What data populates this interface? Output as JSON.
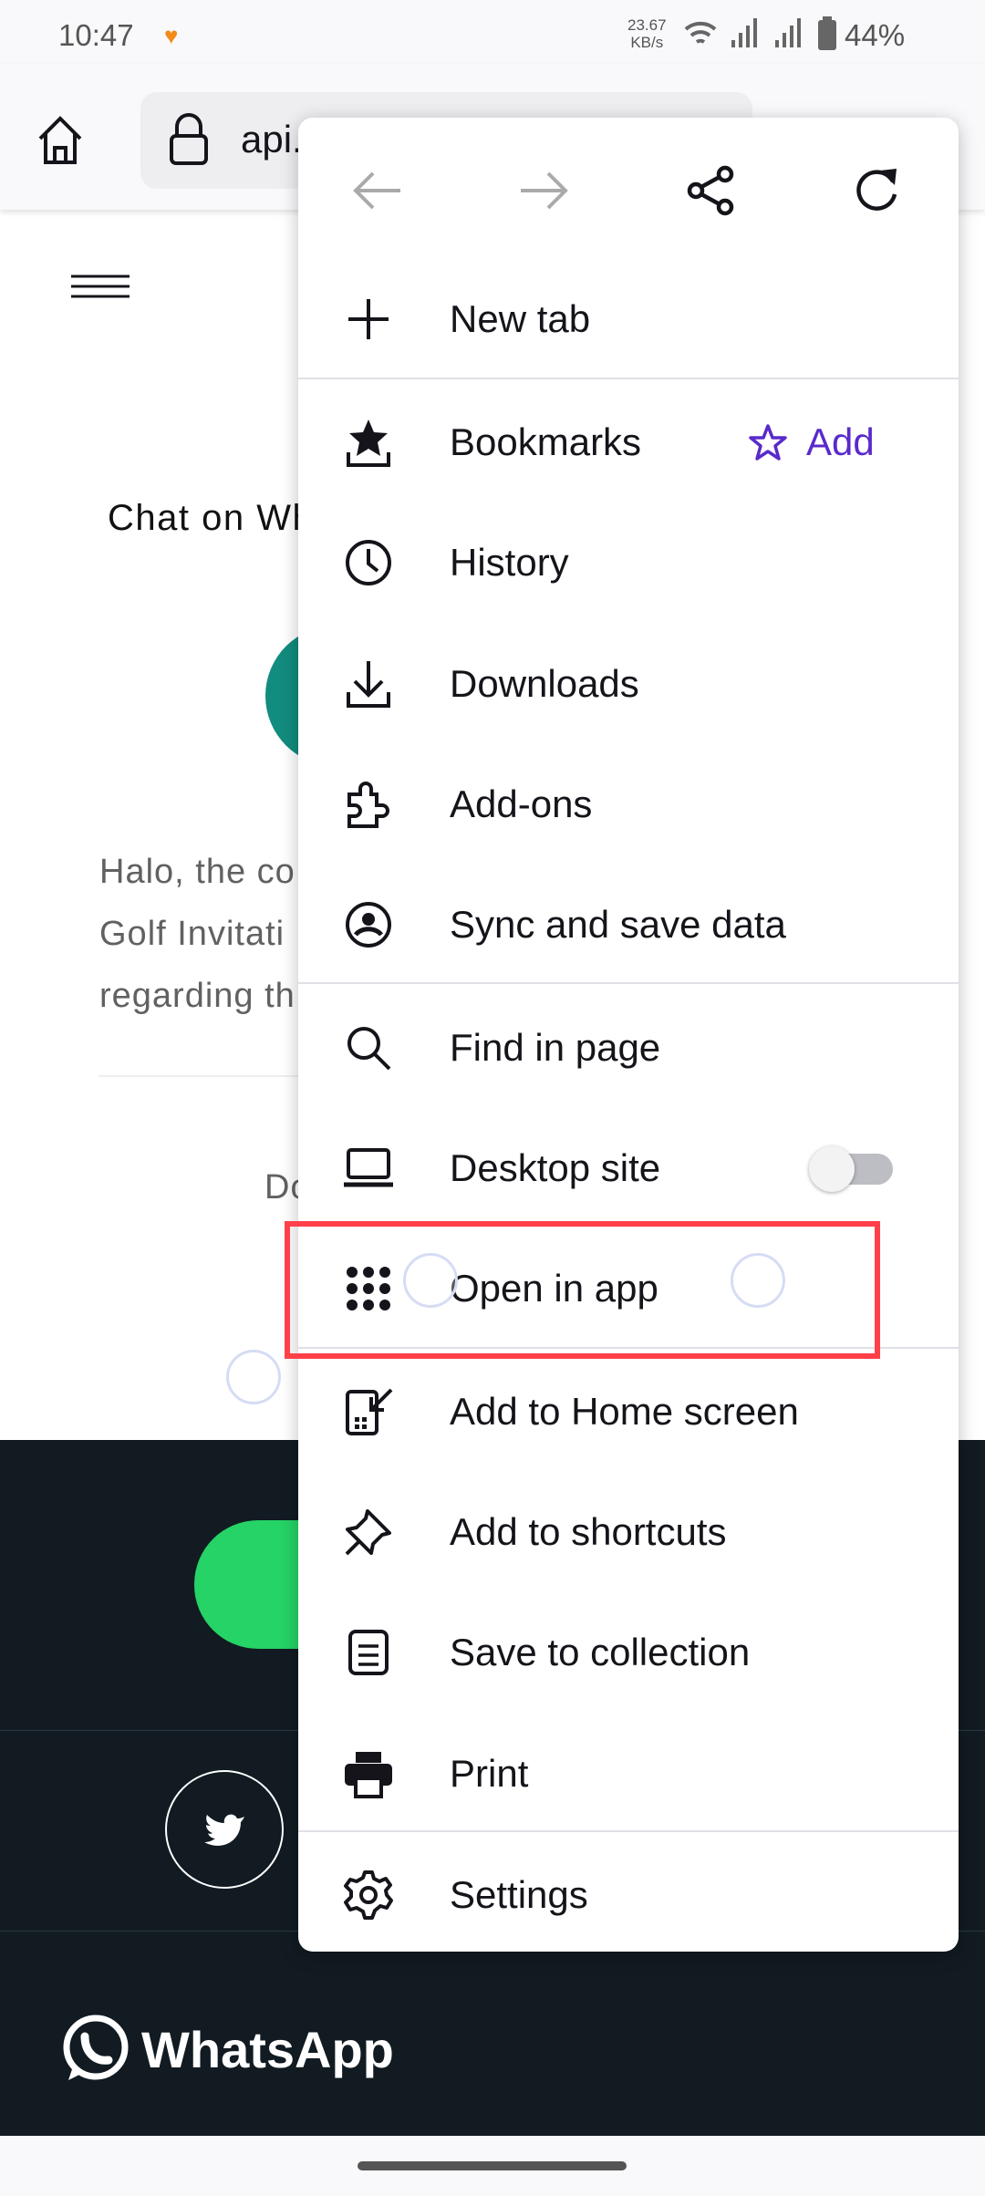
{
  "status_bar": {
    "time": "10:47",
    "net_speed_value": "23.67",
    "net_speed_unit": "KB/s",
    "battery": "44%"
  },
  "toolbar": {
    "url": "api."
  },
  "page": {
    "heading": "Chat on Wh",
    "paragraph": [
      "Halo, the co",
      "Golf Invitati",
      "regarding th"
    ],
    "partial_text": "Do",
    "footer_logo": "WhatsApp"
  },
  "menu": {
    "top_icons": [
      "back-arrow-icon",
      "forward-arrow-icon",
      "share-icon",
      "reload-icon"
    ],
    "items": [
      {
        "label": "New tab",
        "icon": "plus-icon"
      },
      {
        "label": "Bookmarks",
        "icon": "bookmarks-icon",
        "action": "Add"
      },
      {
        "label": "History",
        "icon": "clock-icon"
      },
      {
        "label": "Downloads",
        "icon": "download-icon"
      },
      {
        "label": "Add-ons",
        "icon": "puzzle-icon"
      },
      {
        "label": "Sync and save data",
        "icon": "account-icon"
      },
      {
        "label": "Find in page",
        "icon": "search-icon"
      },
      {
        "label": "Desktop site",
        "icon": "laptop-icon",
        "toggle": false
      },
      {
        "label": "Open in app",
        "icon": "app-grid-icon",
        "highlighted": true
      },
      {
        "label": "Add to Home screen",
        "icon": "add-home-icon"
      },
      {
        "label": "Add to shortcuts",
        "icon": "pin-icon"
      },
      {
        "label": "Save to collection",
        "icon": "collection-icon"
      },
      {
        "label": "Print",
        "icon": "print-icon"
      },
      {
        "label": "Settings",
        "icon": "gear-icon"
      }
    ]
  },
  "colors": {
    "accent": "#592acb",
    "highlight": "#ff4048",
    "footer": "#111b21",
    "whatsapp_green": "#25d366",
    "teal": "#128c7e"
  }
}
